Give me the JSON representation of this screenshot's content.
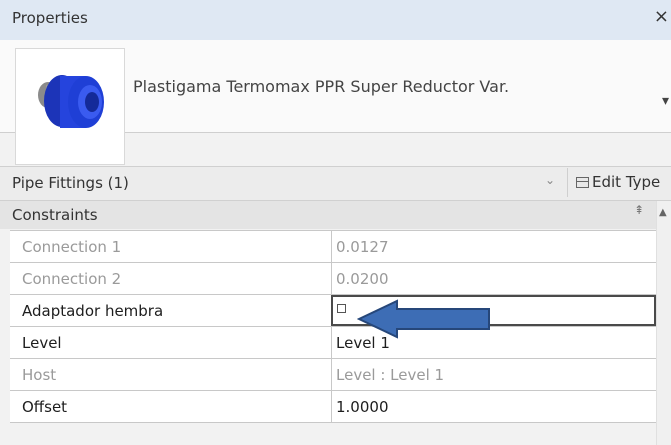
{
  "window": {
    "title": "Properties",
    "close_icon": "×"
  },
  "type_selector": {
    "name": "Plastigama Termomax PPR Super Reductor Var.",
    "dropdown_icon": "▾"
  },
  "selector": {
    "label": "Pipe Fittings (1)",
    "chevron_icon": "⌄",
    "edit_type_label": "Edit Type"
  },
  "group": {
    "label": "Constraints",
    "collapse_icon": "⇞",
    "scroll_up_icon": "▲"
  },
  "rows": [
    {
      "name": "Connection 1",
      "value": "0.0127"
    },
    {
      "name": "Connection 2",
      "value": "0.0200"
    },
    {
      "name": "Adaptador hembra",
      "value": "",
      "checked": false
    },
    {
      "name": "Level",
      "value": "Level 1"
    },
    {
      "name": "Host",
      "value": "Level : Level 1"
    },
    {
      "name": "Offset",
      "value": "1.0000"
    }
  ],
  "colors": {
    "arrow_fill": "#3d6db5",
    "arrow_stroke": "#26477a",
    "fitting_blue": "#1f3fd6"
  }
}
